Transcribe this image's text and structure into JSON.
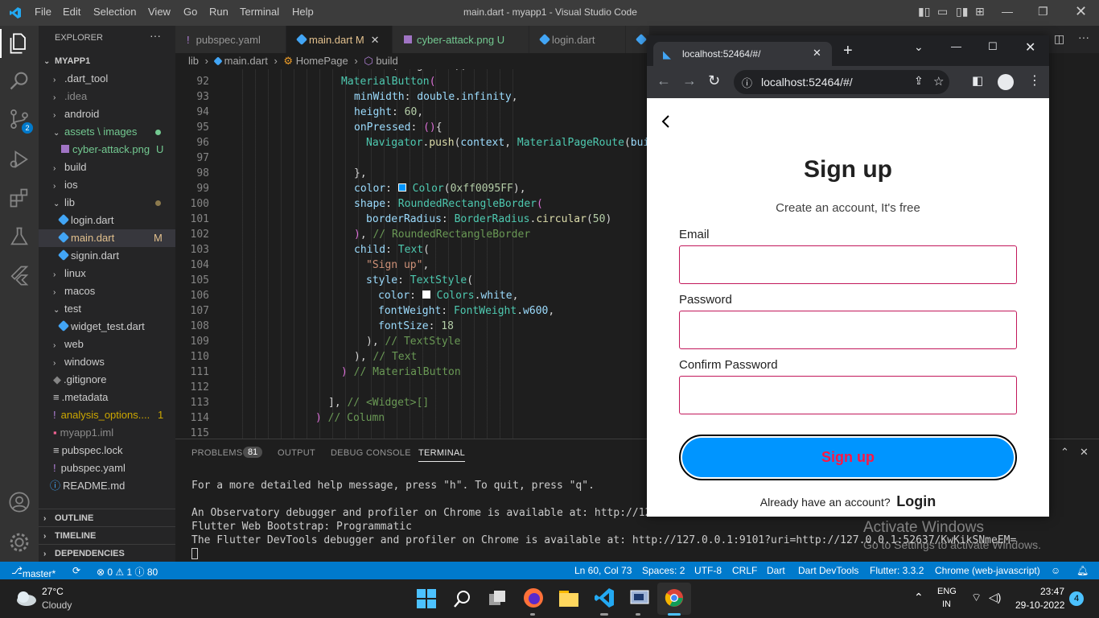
{
  "titlebar": {
    "menus": [
      "File",
      "Edit",
      "Selection",
      "View",
      "Go",
      "Run",
      "Terminal",
      "Help"
    ],
    "title": "main.dart - myapp1 - Visual Studio Code"
  },
  "activity": {
    "source_control_badge": "2"
  },
  "explorer": {
    "header": "EXPLORER",
    "root": "MYAPP1",
    "items": [
      {
        "label": ".dart_tool"
      },
      {
        "label": ".idea"
      },
      {
        "label": "android"
      },
      {
        "label": "assets \\ images"
      },
      {
        "label": "cyber-attack.png",
        "badge": "U"
      },
      {
        "label": "build"
      },
      {
        "label": "ios"
      },
      {
        "label": "lib"
      },
      {
        "label": "login.dart"
      },
      {
        "label": "main.dart",
        "badge": "M"
      },
      {
        "label": "signin.dart"
      },
      {
        "label": "linux"
      },
      {
        "label": "macos"
      },
      {
        "label": "test"
      },
      {
        "label": "widget_test.dart"
      },
      {
        "label": "web"
      },
      {
        "label": "windows"
      },
      {
        "label": ".gitignore"
      },
      {
        "label": ".metadata"
      },
      {
        "label": "analysis_options....",
        "badge": "1"
      },
      {
        "label": "myapp1.iml"
      },
      {
        "label": "pubspec.lock"
      },
      {
        "label": "pubspec.yaml"
      },
      {
        "label": "README.md"
      }
    ],
    "sections": [
      "OUTLINE",
      "TIMELINE",
      "DEPENDENCIES"
    ]
  },
  "tabs": [
    {
      "label": "pubspec.yaml"
    },
    {
      "label": "main.dart",
      "badge": "M"
    },
    {
      "label": "cyber-attack.png",
      "badge": "U"
    },
    {
      "label": "login.dart"
    }
  ],
  "breadcrumb": {
    "p1": "lib",
    "p2": "main.dart",
    "p3": "HomePage",
    "p4": "build"
  },
  "editor": {
    "lines": [
      "92",
      "93",
      "94",
      "95",
      "96",
      "97",
      "98",
      "99",
      "100",
      "101",
      "102",
      "103",
      "104",
      "105",
      "106",
      "107",
      "108",
      "109",
      "110",
      "111",
      "112",
      "113",
      "114",
      "115"
    ]
  },
  "panel": {
    "tabs": [
      "PROBLEMS",
      "OUTPUT",
      "DEBUG CONSOLE",
      "TERMINAL"
    ],
    "problems_count": "81",
    "terminal": [
      "For a more detailed help message, press \"h\". To quit, press \"q\".",
      "",
      "An Observatory debugger and profiler on Chrome is available at: http://127.0.0.1:",
      "Flutter Web Bootstrap: Programmatic",
      "The Flutter DevTools debugger and profiler on Chrome is available at: http://127.0.0.1:9101?uri=http://127.0.0.1:52637/KwKikSNmeEM="
    ],
    "activate1": "Activate Windows",
    "activate2": "Go to Settings to activate Windows."
  },
  "statusbar": {
    "branch": "master*",
    "problems": "⊗ 0 ⚠ 1 ⓘ 80",
    "position": "Ln 60, Col 73",
    "spaces": "Spaces: 2",
    "encoding": "UTF-8",
    "eol": "CRLF",
    "lang": "Dart",
    "devtools": "Dart DevTools",
    "flutter": "Flutter: 3.3.2",
    "device": "Chrome (web-javascript)"
  },
  "browser": {
    "tab_title": "localhost:52464/#/",
    "url": "localhost:52464/#/"
  },
  "app": {
    "title": "Sign up",
    "subtitle": "Create an account, It's free",
    "email_label": "Email",
    "password_label": "Password",
    "confirm_label": "Confirm Password",
    "button": "Sign up",
    "have_account": "Already have an account?",
    "login": "Login"
  },
  "taskbar": {
    "weather_temp": "27°C",
    "weather_desc": "Cloudy",
    "lang1": "ENG",
    "lang2": "IN",
    "time": "23:47",
    "date": "29-10-2022",
    "notif": "4"
  },
  "colors": {
    "accent": "#007acc",
    "button": "#0095ff",
    "field_border": "#c2185b"
  }
}
